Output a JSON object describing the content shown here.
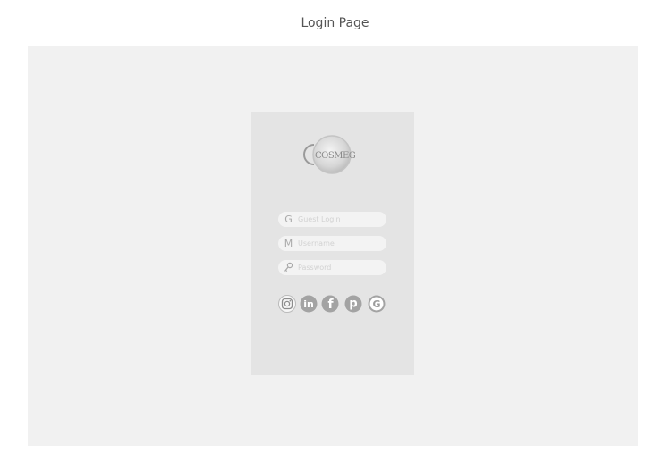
{
  "page": {
    "title": "Login Page"
  },
  "logo": {
    "text": "COSMEG",
    "icon": "cosmeg-logo"
  },
  "form": {
    "guest": {
      "icon": "guest-g-icon",
      "glyph": "G",
      "placeholder": "Guest Login"
    },
    "username": {
      "icon": "mail-m-icon",
      "glyph": "M",
      "placeholder": "Username"
    },
    "password": {
      "icon": "key-icon",
      "placeholder": "Password"
    }
  },
  "social": [
    {
      "name": "instagram",
      "icon": "instagram-icon"
    },
    {
      "name": "linkedin",
      "icon": "linkedin-icon",
      "glyph": "in"
    },
    {
      "name": "facebook",
      "icon": "facebook-icon",
      "glyph": "f"
    },
    {
      "name": "pinterest",
      "icon": "pinterest-icon",
      "glyph": "p"
    },
    {
      "name": "google",
      "icon": "google-icon",
      "glyph": "G"
    }
  ],
  "colors": {
    "frame_bg": "#f1f1f1",
    "card_bg": "#e4e4e4",
    "field_bg": "#f3f3f3",
    "icon_gray": "#a9a9a9"
  }
}
